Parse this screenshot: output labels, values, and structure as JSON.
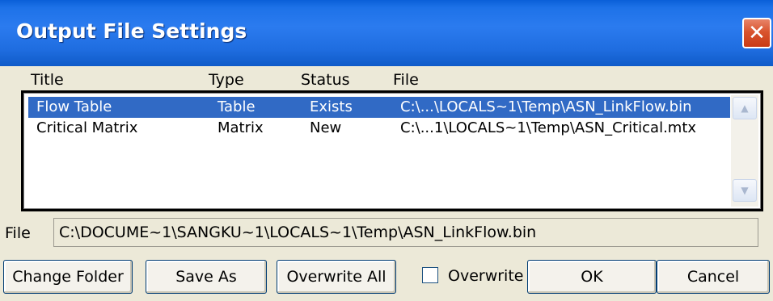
{
  "window": {
    "title": "Output File Settings",
    "close_glyph": "✕"
  },
  "columns": [
    "Title",
    "Type",
    "Status",
    "File"
  ],
  "rows": [
    {
      "title": "Flow Table",
      "type": "Table",
      "status": "Exists",
      "file": "C:\\...\\LOCALS~1\\Temp\\ASN_LinkFlow.bin",
      "selected": true
    },
    {
      "title": "Critical Matrix",
      "type": "Matrix",
      "status": "New",
      "file": "C:\\...1\\LOCALS~1\\Temp\\ASN_Critical.mtx",
      "selected": false
    }
  ],
  "scrollbar": {
    "up_glyph": "▲",
    "down_glyph": "▼"
  },
  "file_field": {
    "label": "File",
    "value": "C:\\DOCUME~1\\SANGKU~1\\LOCALS~1\\Temp\\ASN_LinkFlow.bin"
  },
  "buttons": {
    "change_folder": "Change Folder",
    "save_as": "Save As",
    "overwrite_all": "Overwrite All",
    "ok": "OK",
    "cancel": "Cancel"
  },
  "overwrite_checkbox": {
    "label": "Overwrite",
    "checked": false
  },
  "colors": {
    "title_bar": "#1f6de0",
    "selection": "#316ac5",
    "close": "#d9542e"
  }
}
